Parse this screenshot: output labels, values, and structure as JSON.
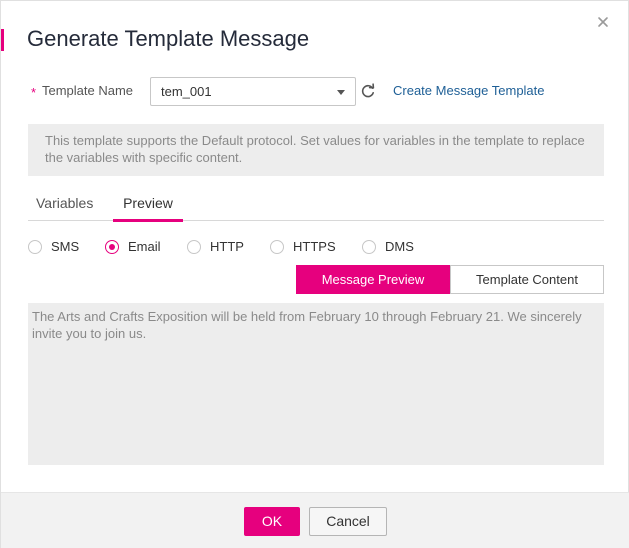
{
  "dialog": {
    "title": "Generate Template Message"
  },
  "template_name": {
    "required_mark": "*",
    "label": "Template Name",
    "value": "tem_001",
    "create_link": "Create Message Template"
  },
  "notice": "This template supports the Default protocol. Set values for variables in the template to replace the variables with specific content.",
  "tabs": [
    {
      "label": "Variables",
      "active": false
    },
    {
      "label": "Preview",
      "active": true
    }
  ],
  "protocols": [
    {
      "label": "SMS",
      "checked": false
    },
    {
      "label": "Email",
      "checked": true
    },
    {
      "label": "HTTP",
      "checked": false
    },
    {
      "label": "HTTPS",
      "checked": false
    },
    {
      "label": "DMS",
      "checked": false
    }
  ],
  "view_toggle": {
    "active": "Message Preview",
    "inactive": "Template Content"
  },
  "preview_text": "The Arts and Crafts Exposition will be held from February 10 through February 21. We sincerely invite you to join us.",
  "footer": {
    "ok_label": "OK",
    "cancel_label": "Cancel"
  },
  "colors": {
    "accent": "#e6007e",
    "link": "#1e5f96",
    "panel_bg": "#ededed"
  },
  "icons": [
    "close-icon",
    "refresh-icon",
    "chevron-down-icon"
  ]
}
